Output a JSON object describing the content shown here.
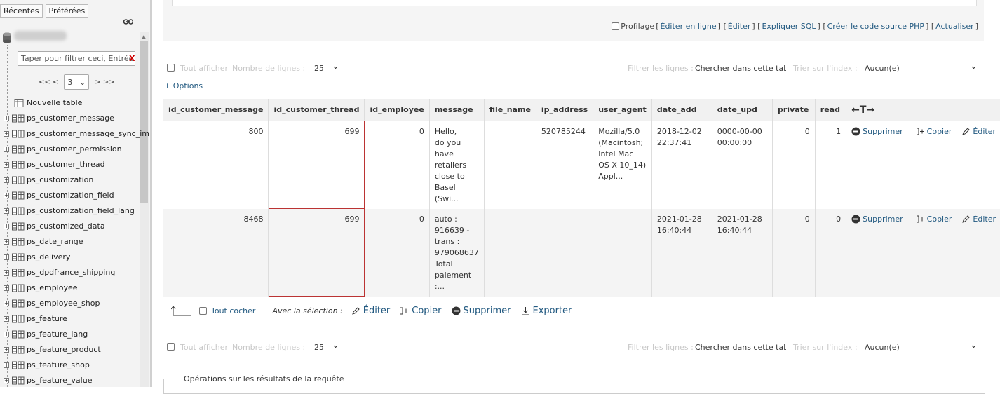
{
  "sidebar": {
    "tabs": [
      "Récentes",
      "Préférées"
    ],
    "filter_placeholder": "Taper pour filtrer ceci, Entrée pour",
    "pager": {
      "prev": "<< <",
      "page": "3",
      "next": "> >>"
    },
    "new_table": "Nouvelle table",
    "tables": [
      "ps_customer_message",
      "ps_customer_message_sync_im",
      "ps_customer_permission",
      "ps_customer_thread",
      "ps_customization",
      "ps_customization_field",
      "ps_customization_field_lang",
      "ps_customized_data",
      "ps_date_range",
      "ps_delivery",
      "ps_dpdfrance_shipping",
      "ps_employee",
      "ps_employee_shop",
      "ps_feature",
      "ps_feature_lang",
      "ps_feature_product",
      "ps_feature_shop",
      "ps_feature_value"
    ]
  },
  "sql_links": {
    "profiling": "Profilage",
    "edit_inline": "Éditer en ligne",
    "edit": "Éditer",
    "explain": "Expliquer SQL",
    "php": "Créer le code source PHP",
    "refresh": "Actualiser"
  },
  "navbar": {
    "show_all": "Tout afficher",
    "rows_label": "Nombre de lignes :",
    "rows_value": "25",
    "filter_label": "Filtrer les lignes :",
    "filter_placeholder": "Chercher dans cette table",
    "sort_label": "Trier sur l'index :",
    "sort_value": "Aucun(e)"
  },
  "options_link": "+ Options",
  "table": {
    "columns": [
      "id_customer_message",
      "id_customer_thread",
      "id_employee",
      "message",
      "file_name",
      "ip_address",
      "user_agent",
      "date_add",
      "date_upd",
      "private",
      "read"
    ],
    "arrows": "←T→",
    "actions": {
      "delete": "Supprimer",
      "copy": "Copier",
      "edit": "Éditer"
    },
    "rows": [
      {
        "id_customer_message": "800",
        "id_customer_thread": "699",
        "id_employee": "0",
        "message": "Hello,\ndo you\nhave\nretailers\nclose to\nBasel\n(Swi...",
        "file_name": "",
        "ip_address": "520785244",
        "user_agent": "Mozilla/5.0\n(Macintosh;\nIntel Mac\nOS X 10_14)\nAppl...",
        "date_add": "2018-12-02 22:37:41",
        "date_upd": "0000-00-00 00:00:00",
        "private": "0",
        "read": "1"
      },
      {
        "id_customer_message": "8468",
        "id_customer_thread": "699",
        "id_employee": "0",
        "message": "auto :\n916639 -\ntrans :\n979068637\nTotal\npaiement\n:...",
        "file_name": "",
        "ip_address": "",
        "user_agent": "",
        "date_add": "2021-01-28 16:40:44",
        "date_upd": "2021-01-28 16:40:44",
        "private": "0",
        "read": "0"
      }
    ]
  },
  "bulk": {
    "check_all": "Tout cocher",
    "with_selection": "Avec la sélection :",
    "edit": "Éditer",
    "copy": "Copier",
    "delete": "Supprimer",
    "export": "Exporter"
  },
  "ops_legend": "Opérations sur les résultats de la requête"
}
